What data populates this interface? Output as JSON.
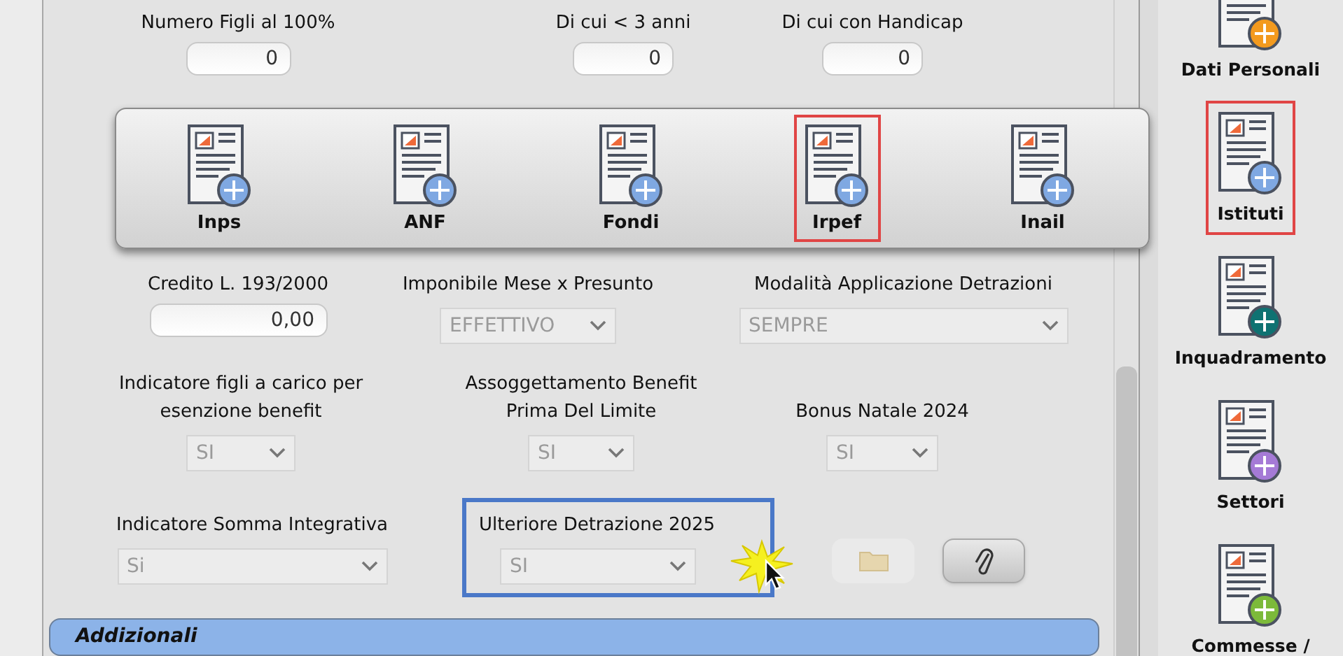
{
  "form_rows": [
    {
      "fields": [
        {
          "label": "Numero Figli al 100%",
          "kind": "input",
          "value": "0"
        },
        {
          "label": "Di cui < 3 anni",
          "kind": "input",
          "value": "0"
        },
        {
          "label": "Di cui con Handicap",
          "kind": "input",
          "value": "0"
        }
      ]
    },
    {
      "fields": [
        {
          "label": "Credito L. 193/2000",
          "kind": "input",
          "value": "0,00"
        },
        {
          "label": "Imponibile Mese x Presunto",
          "kind": "select",
          "value": "EFFETTIVO",
          "disabled": true
        },
        {
          "label": "Modalità Applicazione Detrazioni",
          "kind": "select",
          "value": "SEMPRE",
          "disabled": true
        }
      ]
    },
    {
      "fields": [
        {
          "label": "Indicatore figli a carico per esenzione benefit",
          "kind": "select",
          "value": "SI",
          "disabled": true
        },
        {
          "label": "Assoggettamento Benefit Prima Del Limite",
          "kind": "select",
          "value": "SI",
          "disabled": true
        },
        {
          "label": "Bonus Natale 2024",
          "kind": "select",
          "value": "SI",
          "disabled": true
        }
      ]
    },
    {
      "fields": [
        {
          "label": "Indicatore Somma Integrativa",
          "kind": "select",
          "value": "Si",
          "disabled": true
        },
        {
          "label": "Ulteriore Detrazione 2025",
          "kind": "select",
          "value": "SI",
          "disabled": true,
          "highlighted": true
        }
      ]
    }
  ],
  "action_buttons": [
    {
      "kind": "folder",
      "disabled": true
    },
    {
      "kind": "attach",
      "disabled": false
    }
  ],
  "section": {
    "title": "Addizionali"
  },
  "toolbar": {
    "items": [
      {
        "label": "Inps",
        "selected": false
      },
      {
        "label": "ANF",
        "selected": false
      },
      {
        "label": "Fondi",
        "selected": false
      },
      {
        "label": "Irpef",
        "selected": true
      },
      {
        "label": "Inail",
        "selected": false
      }
    ]
  },
  "sidebar": {
    "items": [
      {
        "label": "Dati Personali",
        "selected": false,
        "color": "#f39a1e"
      },
      {
        "label": "Istituti",
        "selected": true,
        "color": "#7fa8e2"
      },
      {
        "label": "Inquadramento",
        "selected": false,
        "color": "#0f7272"
      },
      {
        "label": "Settori",
        "selected": false,
        "color": "#a57ad6"
      },
      {
        "label": "Commesse /",
        "selected": false,
        "color": "#7cba3a"
      }
    ]
  }
}
